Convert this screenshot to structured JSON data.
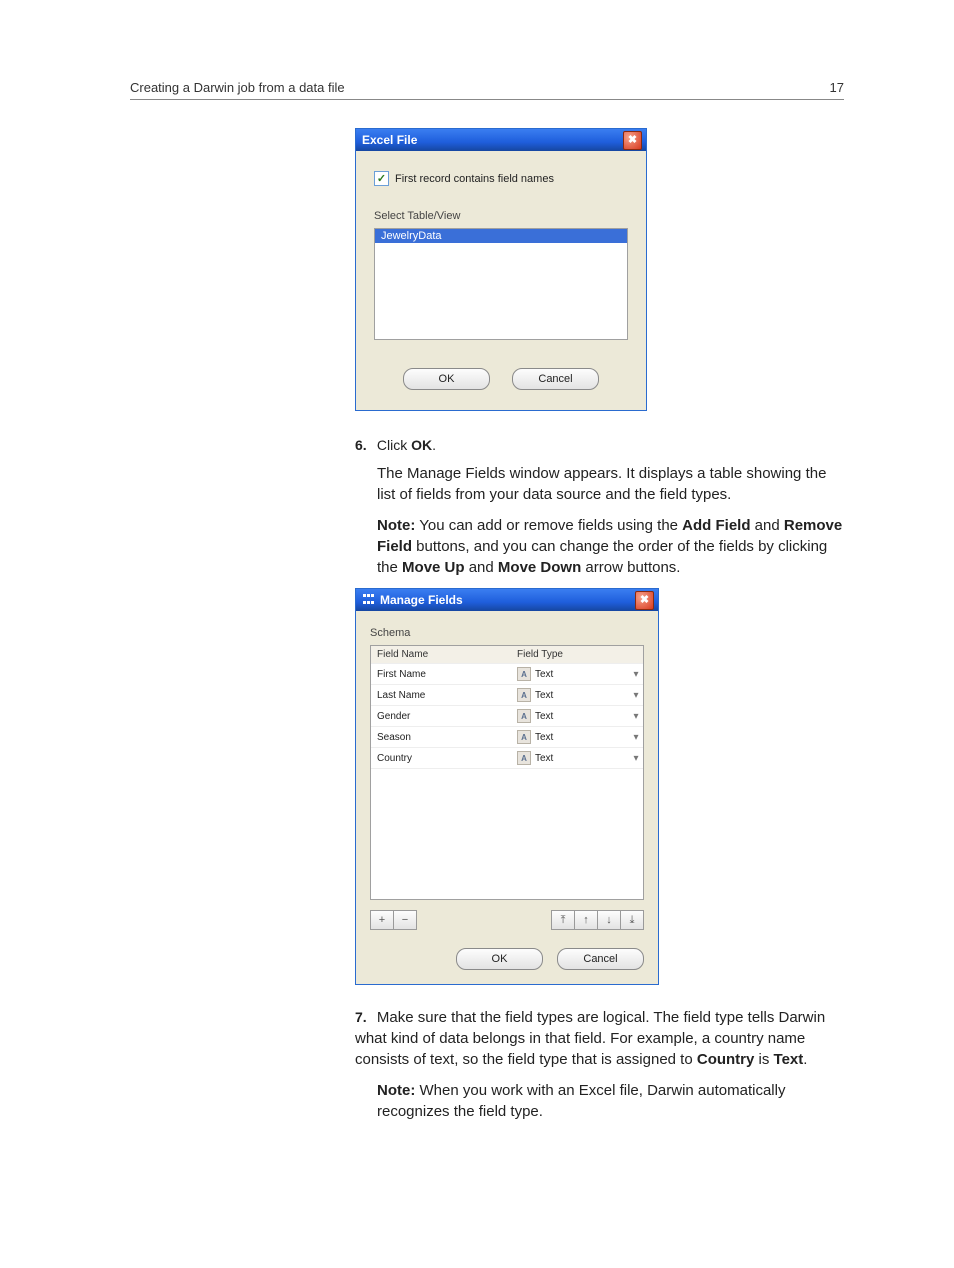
{
  "header": {
    "title": "Creating a Darwin job from a data file",
    "page_number": "17"
  },
  "dialog1": {
    "title": "Excel File",
    "checkbox_label": "First record contains field names",
    "section_label": "Select Table/View",
    "selected_item": "JewelryData",
    "ok_label": "OK",
    "cancel_label": "Cancel"
  },
  "step6": {
    "num": "6.",
    "line": "Click ",
    "ok_word": "OK",
    "period": ".",
    "para1": "The Manage Fields window appears. It displays a table showing the list of fields from your data source and the field types.",
    "note_label": "Note:",
    "note_part1": " You can add or remove fields using the ",
    "add_field": "Add Field",
    "note_part2": " and ",
    "remove_field": "Remove Field",
    "note_part3": " buttons, and you can change the order of the fields by clicking the ",
    "move_up": "Move Up",
    "note_part4": " and ",
    "move_down": "Move Down",
    "note_part5": " arrow buttons."
  },
  "dialog2": {
    "title": "Manage Fields",
    "schema_label": "Schema",
    "col_name": "Field Name",
    "col_type": "Field Type",
    "rows": [
      {
        "name": "First Name",
        "type": "Text"
      },
      {
        "name": "Last Name",
        "type": "Text"
      },
      {
        "name": "Gender",
        "type": "Text"
      },
      {
        "name": "Season",
        "type": "Text"
      },
      {
        "name": "Country",
        "type": "Text"
      }
    ],
    "plus": "+",
    "minus": "−",
    "top": "⤒",
    "up": "↑",
    "down": "↓",
    "bottom": "⤓",
    "ok_label": "OK",
    "cancel_label": "Cancel",
    "type_glyph": "A",
    "drop_glyph": "▾"
  },
  "step7": {
    "num": "7.",
    "part1": "Make sure that the field types are logical. The field type tells Darwin what kind of data belongs in that field. For example, a country name consists of text, so the field type that is assigned to ",
    "country": "Country",
    "part2": " is ",
    "text_word": "Text",
    "period": ".",
    "note_label": "Note:",
    "note_body": " When you work with an Excel file, Darwin automatically recognizes the field type."
  }
}
